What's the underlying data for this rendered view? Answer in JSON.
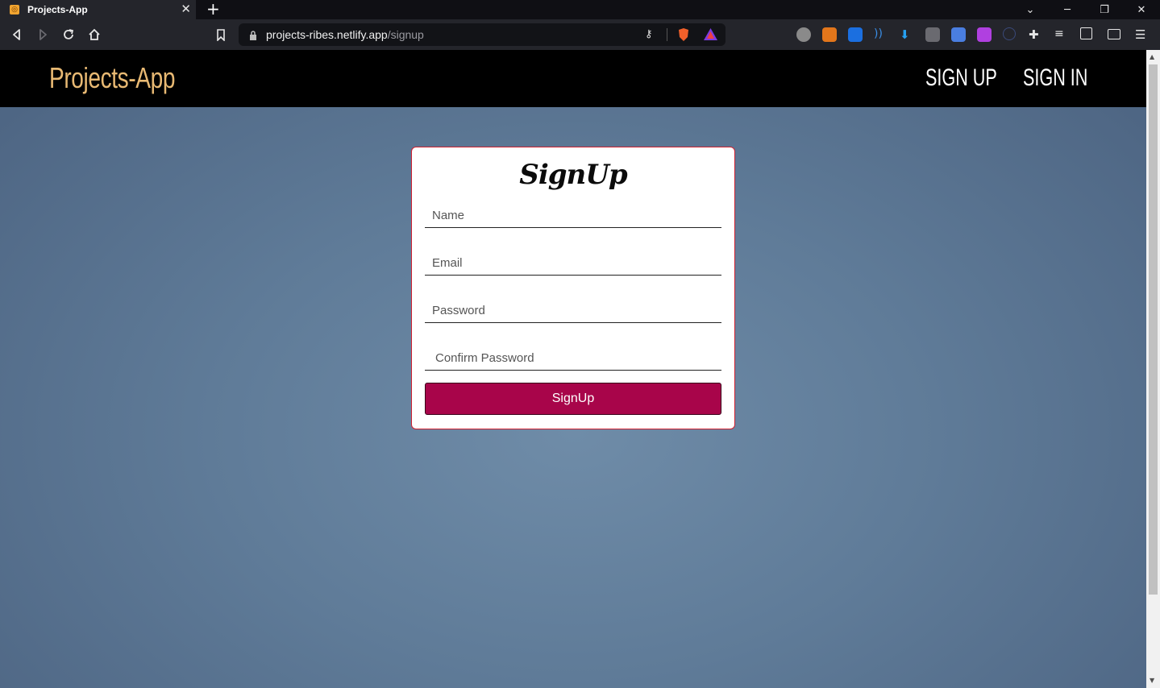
{
  "browser": {
    "tab_title": "Projects-App",
    "url_host": "projects-ribes.netlify.app",
    "url_path": "/signup"
  },
  "navbar": {
    "brand": "Projects-App",
    "links": [
      "SIGN UP",
      "SIGN IN"
    ]
  },
  "form": {
    "title": "SignUp",
    "fields": [
      {
        "placeholder": "Name",
        "value": ""
      },
      {
        "placeholder": "Email",
        "value": ""
      },
      {
        "placeholder": "Password",
        "value": ""
      },
      {
        "placeholder": "Confirm Password",
        "value": ""
      }
    ],
    "submit_label": "SignUp"
  },
  "colors": {
    "brand": "#e8b973",
    "button": "#a8054a",
    "card_border": "#d02030",
    "background": "#6f8ca8"
  }
}
